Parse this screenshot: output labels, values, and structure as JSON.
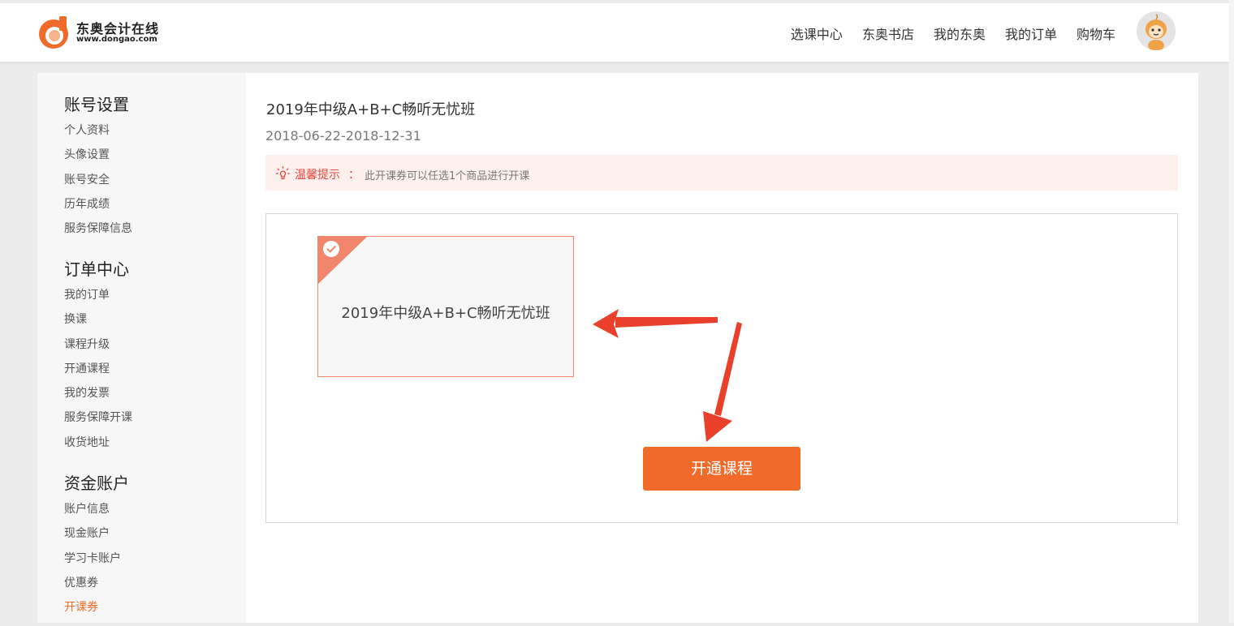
{
  "colors": {
    "accent": "#f06b2a",
    "tip_red": "#e8453c",
    "arrow": "#e8402a",
    "tip_background": "#fdf0ed",
    "card_border": "#f2866c"
  },
  "header": {
    "logo": {
      "title": "东奥会计在线",
      "url": "www.dongao.com"
    },
    "nav": [
      {
        "label": "选课中心"
      },
      {
        "label": "东奥书店"
      },
      {
        "label": "我的东奥"
      },
      {
        "label": "我的订单"
      },
      {
        "label": "购物车"
      }
    ],
    "avatar_icon": "cartoon-avatar-icon"
  },
  "sidebar": {
    "sections": [
      {
        "heading": "账号设置",
        "items": [
          {
            "label": "个人资料"
          },
          {
            "label": "头像设置"
          },
          {
            "label": "账号安全"
          },
          {
            "label": "历年成绩"
          },
          {
            "label": "服务保障信息"
          }
        ]
      },
      {
        "heading": "订单中心",
        "items": [
          {
            "label": "我的订单"
          },
          {
            "label": "换课"
          },
          {
            "label": "课程升级"
          },
          {
            "label": "开通课程"
          },
          {
            "label": "我的发票"
          },
          {
            "label": "服务保障开课"
          },
          {
            "label": "收货地址"
          }
        ]
      },
      {
        "heading": "资金账户",
        "items": [
          {
            "label": "账户信息"
          },
          {
            "label": "现金账户"
          },
          {
            "label": "学习卡账户"
          },
          {
            "label": "优惠券"
          },
          {
            "label": "开课券",
            "active": true
          }
        ]
      }
    ]
  },
  "main": {
    "voucher_title": "2019年中级A+B+C畅听无忧班",
    "voucher_date": "2018-06-22-2018-12-31",
    "tip": {
      "icon": "lightbulb-icon",
      "label": "温馨提示",
      "colon": "：",
      "text": "此开课券可以任选1个商品进行开课"
    },
    "course_card": {
      "name": "2019年中级A+B+C畅听无忧班",
      "selected": true,
      "check_icon": "checkmark-icon"
    },
    "open_button_label": "开通课程",
    "annotations": [
      "arrow-left-icon",
      "arrow-down-icon"
    ]
  }
}
